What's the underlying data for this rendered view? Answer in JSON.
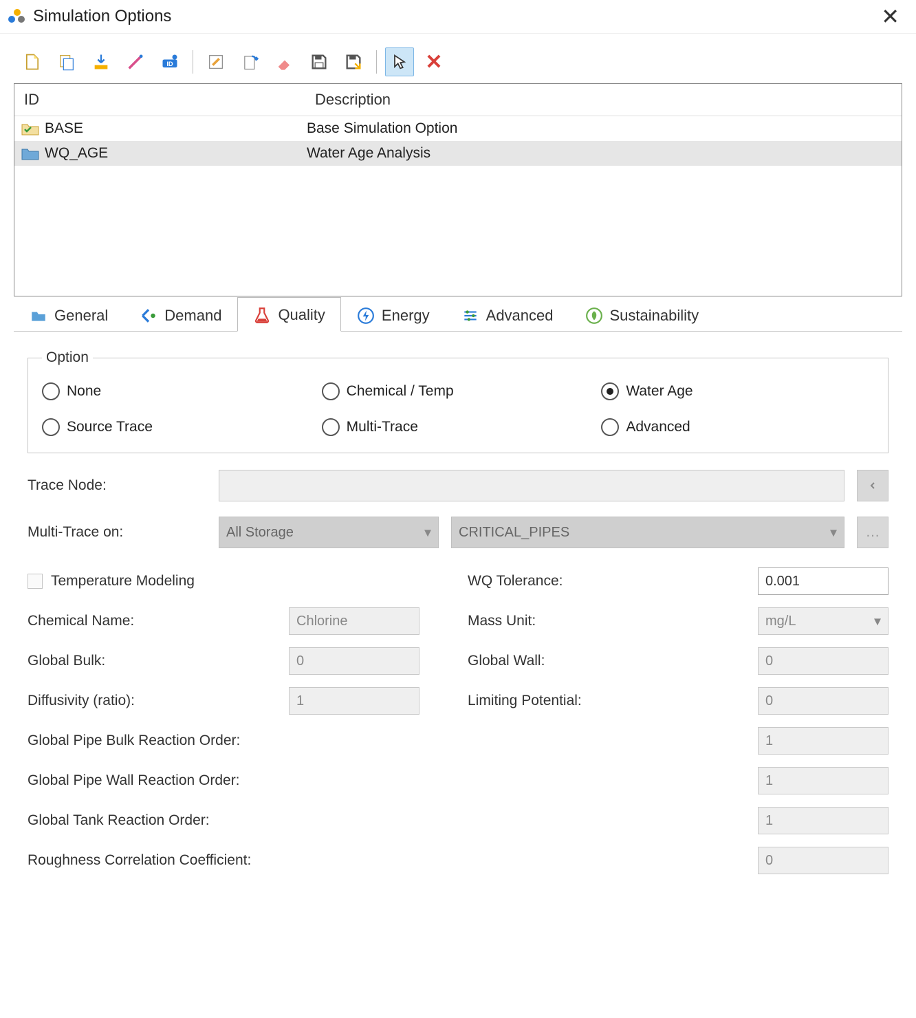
{
  "titlebar": {
    "title": "Simulation Options"
  },
  "list": {
    "headers": {
      "id": "ID",
      "desc": "Description"
    },
    "rows": [
      {
        "id": "BASE",
        "desc": "Base Simulation Option",
        "selected": false,
        "icon": "folder-check"
      },
      {
        "id": "WQ_AGE",
        "desc": "Water Age Analysis",
        "selected": true,
        "icon": "folder"
      }
    ]
  },
  "tabs": {
    "items": [
      {
        "label": "General"
      },
      {
        "label": "Demand"
      },
      {
        "label": "Quality"
      },
      {
        "label": "Energy"
      },
      {
        "label": "Advanced"
      },
      {
        "label": "Sustainability"
      }
    ],
    "active": 2
  },
  "option_group": {
    "legend": "Option",
    "items": [
      {
        "label": "None",
        "checked": false
      },
      {
        "label": "Chemical / Temp",
        "checked": false
      },
      {
        "label": "Water Age",
        "checked": true
      },
      {
        "label": "Source Trace",
        "checked": false
      },
      {
        "label": "Multi-Trace",
        "checked": false
      },
      {
        "label": "Advanced",
        "checked": false
      }
    ]
  },
  "fields": {
    "trace_node": {
      "label": "Trace Node:",
      "value": ""
    },
    "multi_trace": {
      "label": "Multi-Trace on:",
      "sel1": "All Storage",
      "sel2": "CRITICAL_PIPES"
    },
    "temp_model": {
      "label": "Temperature Modeling"
    },
    "wq_tol": {
      "label": "WQ Tolerance:",
      "value": "0.001"
    },
    "chem_name": {
      "label": "Chemical Name:",
      "value": "Chlorine"
    },
    "mass_unit": {
      "label": "Mass Unit:",
      "value": "mg/L"
    },
    "global_bulk": {
      "label": "Global Bulk:",
      "value": "0"
    },
    "global_wall": {
      "label": "Global Wall:",
      "value": "0"
    },
    "diffusivity": {
      "label": "Diffusivity (ratio):",
      "value": "1"
    },
    "limiting": {
      "label": "Limiting Potential:",
      "value": "0"
    },
    "pipe_bulk_order": {
      "label": "Global Pipe Bulk Reaction Order:",
      "value": "1"
    },
    "pipe_wall_order": {
      "label": "Global Pipe Wall Reaction Order:",
      "value": "1"
    },
    "tank_order": {
      "label": "Global Tank Reaction Order:",
      "value": "1"
    },
    "rough_coeff": {
      "label": "Roughness Correlation Coefficient:",
      "value": "0"
    }
  }
}
